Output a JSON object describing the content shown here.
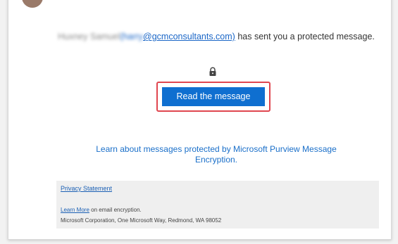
{
  "header": {
    "avatar_color": "#9a7a69"
  },
  "message": {
    "sender_name": "Huxney Samuel",
    "sender_email_prefix": "(harry",
    "sender_email_domain": "@gcmconsultants.com)",
    "sent_text": "has sent you a protected message."
  },
  "icons": {
    "lock": "lock-icon"
  },
  "actions": {
    "read_button_label": "Read the message",
    "learn_link_text": "Learn about messages protected by Microsoft Purview Message Encryption."
  },
  "footer": {
    "privacy_label": "Privacy Statement",
    "learn_more_label": "Learn More",
    "learn_more_suffix": " on email encryption.",
    "address": "Microsoft Corporation, One Microsoft Way, Redmond, WA 98052"
  },
  "colors": {
    "button": "#0f6fd0",
    "highlight_border": "#e0464f",
    "link": "#1a6fc9"
  }
}
